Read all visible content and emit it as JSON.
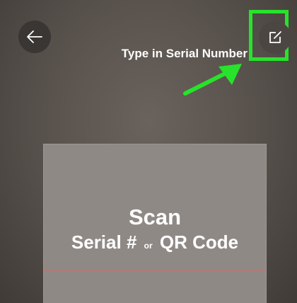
{
  "toolbar": {
    "back_icon": "arrow-left-icon",
    "edit_icon": "edit-icon"
  },
  "annotation": {
    "text": "Type in Serial Number",
    "highlight_color": "#27e32b"
  },
  "scan": {
    "title": "Scan",
    "line_part1": "Serial #",
    "line_or": "or",
    "line_part2": "QR Code"
  }
}
